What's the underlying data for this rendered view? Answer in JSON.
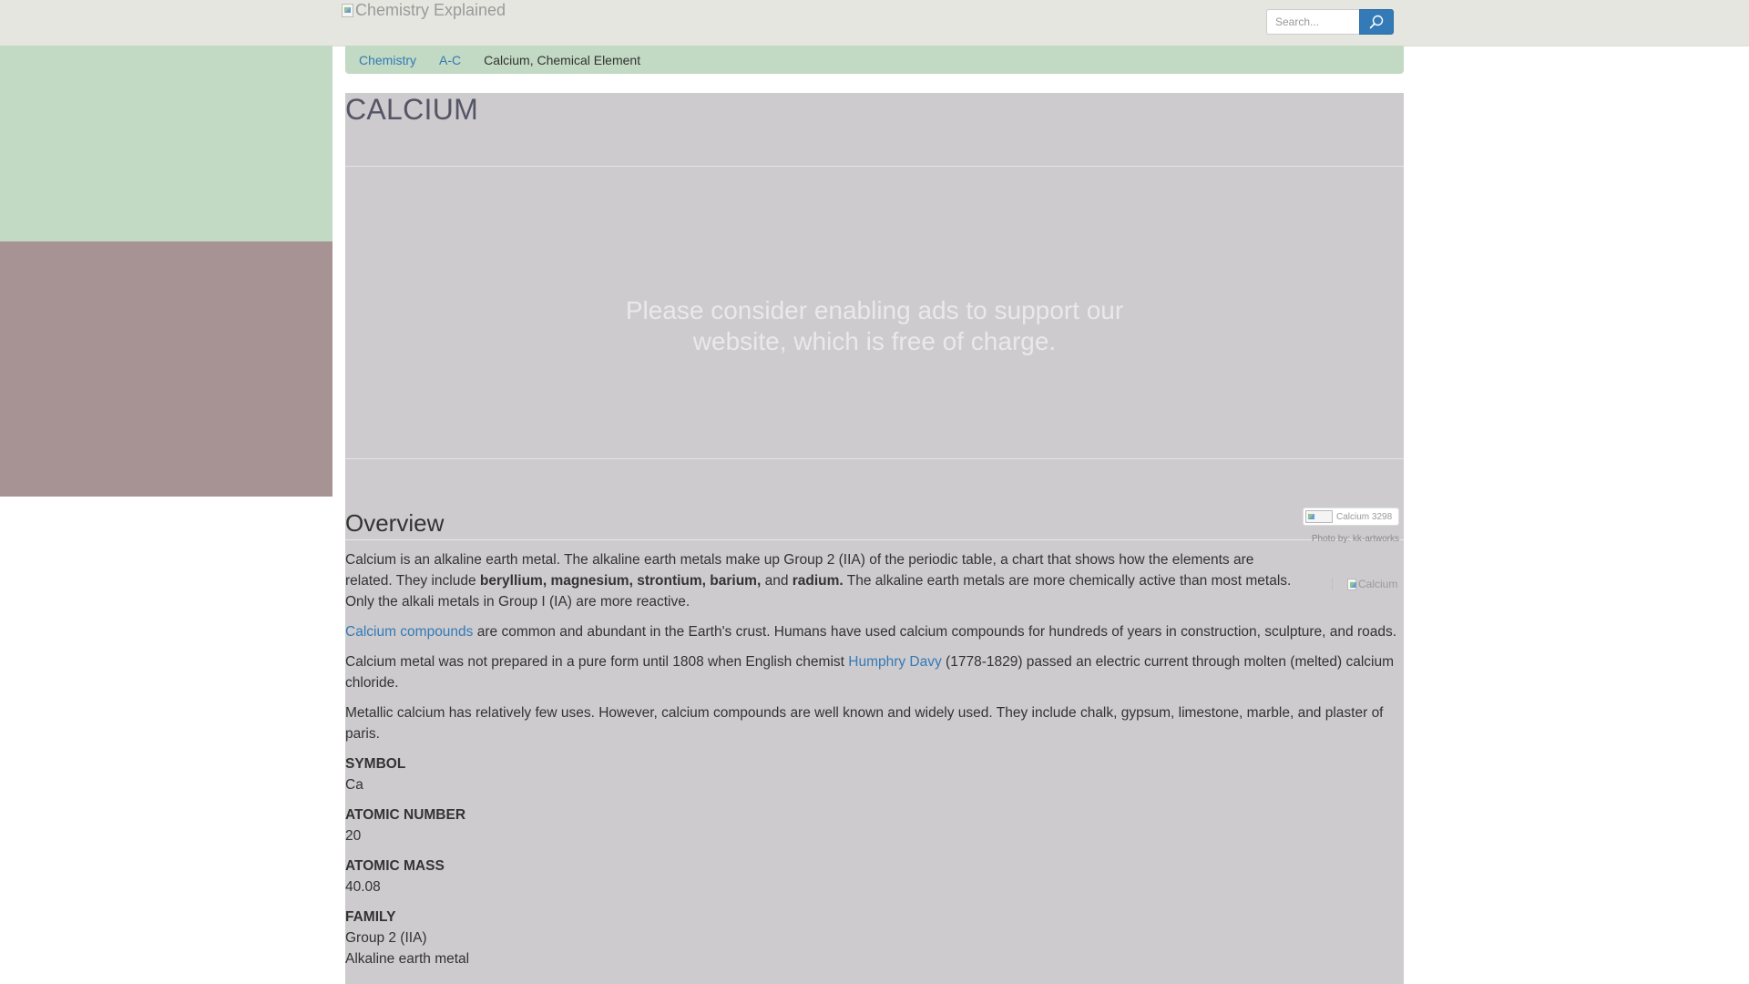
{
  "header": {
    "logo_alt": "Chemistry Explained",
    "search_placeholder": "Search...",
    "search_icon": "search-icon"
  },
  "breadcrumb": {
    "items": [
      "Chemistry",
      "A-C"
    ],
    "current": "Calcium, Chemical Element"
  },
  "page": {
    "title": "CALCIUM",
    "ad_message": "Please consider enabling ads to support our website, which is free of charge.",
    "overview_heading": "Overview",
    "photo_alt": "Calcium 3298",
    "photo_credit": "Photo by: kk-artworks",
    "side_image_alt": "Calcium",
    "paragraph1": {
      "text_a": "Calcium is an alkaline earth metal. The alkaline earth metals make up Group 2 (IIA) of the periodic table, a chart that shows how the elements are related. They include ",
      "bold_a": "beryllium, magnesium, strontium, barium,",
      "text_b": " and ",
      "bold_b": "radium.",
      "text_c": " The alkaline earth metals are more chemically active than most metals. Only the alkali metals in Group I (IA) are more reactive."
    },
    "paragraph2": {
      "link": "Calcium compounds",
      "text": " are common and abundant in the Earth's crust. Humans have used calcium compounds for hundreds of years in construction, sculpture, and roads."
    },
    "paragraph3": {
      "text_a": "Calcium metal was not prepared in a pure form until 1808 when English chemist ",
      "link": "Humphry Davy",
      "text_b": " (1778-1829) passed an electric current through molten (melted) calcium chloride."
    },
    "paragraph4": "Metallic calcium has relatively few uses. However, calcium compounds are well known and widely used. They include chalk, gypsum, limestone, marble, and plaster of paris.",
    "facts": {
      "symbol": {
        "label": "SYMBOL",
        "value": "Ca"
      },
      "atomic_number": {
        "label": "ATOMIC NUMBER",
        "value": "20"
      },
      "atomic_mass": {
        "label": "ATOMIC MASS",
        "value": "40.08"
      },
      "family": {
        "label": "FAMILY",
        "value": "Group 2 (IIA)",
        "value2": "Alkaline earth metal"
      }
    }
  },
  "colors": {
    "topbar": "#e6e6e1",
    "sidebar_green": "#c2d9c3",
    "sidebar_mauve": "#a79393",
    "content_bg": "#cdcbce",
    "link": "#337ab7",
    "search_button": "#337ab7"
  }
}
